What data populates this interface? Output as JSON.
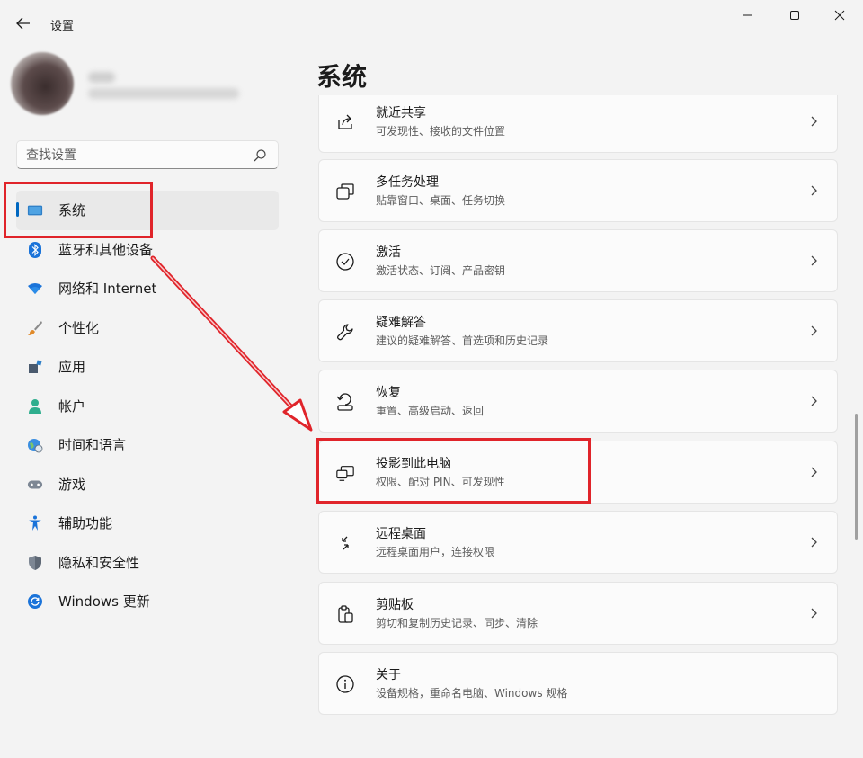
{
  "window": {
    "title": "设置"
  },
  "search": {
    "placeholder": "查找设置"
  },
  "nav": {
    "items": [
      {
        "label": "系统",
        "icon": "system-display-icon",
        "active": true
      },
      {
        "label": "蓝牙和其他设备",
        "icon": "bluetooth-icon"
      },
      {
        "label": "网络和 Internet",
        "icon": "wifi-icon"
      },
      {
        "label": "个性化",
        "icon": "brush-icon"
      },
      {
        "label": "应用",
        "icon": "apps-icon"
      },
      {
        "label": "帐户",
        "icon": "account-icon"
      },
      {
        "label": "时间和语言",
        "icon": "globe-clock-icon"
      },
      {
        "label": "游戏",
        "icon": "gamepad-icon"
      },
      {
        "label": "辅助功能",
        "icon": "accessibility-icon"
      },
      {
        "label": "隐私和安全性",
        "icon": "shield-icon"
      },
      {
        "label": "Windows 更新",
        "icon": "update-icon"
      }
    ]
  },
  "main": {
    "title": "系统",
    "cards": [
      {
        "title": "就近共享",
        "subtitle": "可发现性、接收的文件位置",
        "icon": "share-icon"
      },
      {
        "title": "多任务处理",
        "subtitle": "贴靠窗口、桌面、任务切换",
        "icon": "multitask-icon"
      },
      {
        "title": "激活",
        "subtitle": "激活状态、订阅、产品密钥",
        "icon": "check-circle-icon"
      },
      {
        "title": "疑难解答",
        "subtitle": "建议的疑难解答、首选项和历史记录",
        "icon": "wrench-icon"
      },
      {
        "title": "恢复",
        "subtitle": "重置、高级启动、返回",
        "icon": "recovery-icon"
      },
      {
        "title": "投影到此电脑",
        "subtitle": "权限、配对 PIN、可发现性",
        "icon": "project-icon"
      },
      {
        "title": "远程桌面",
        "subtitle": "远程桌面用户，连接权限",
        "icon": "remote-desktop-icon"
      },
      {
        "title": "剪贴板",
        "subtitle": "剪切和复制历史记录、同步、清除",
        "icon": "clipboard-icon"
      },
      {
        "title": "关于",
        "subtitle": "设备规格，重命名电脑、Windows 规格",
        "icon": "info-icon"
      }
    ]
  },
  "colors": {
    "accent": "#0067c0",
    "annotation": "#e0242a"
  }
}
